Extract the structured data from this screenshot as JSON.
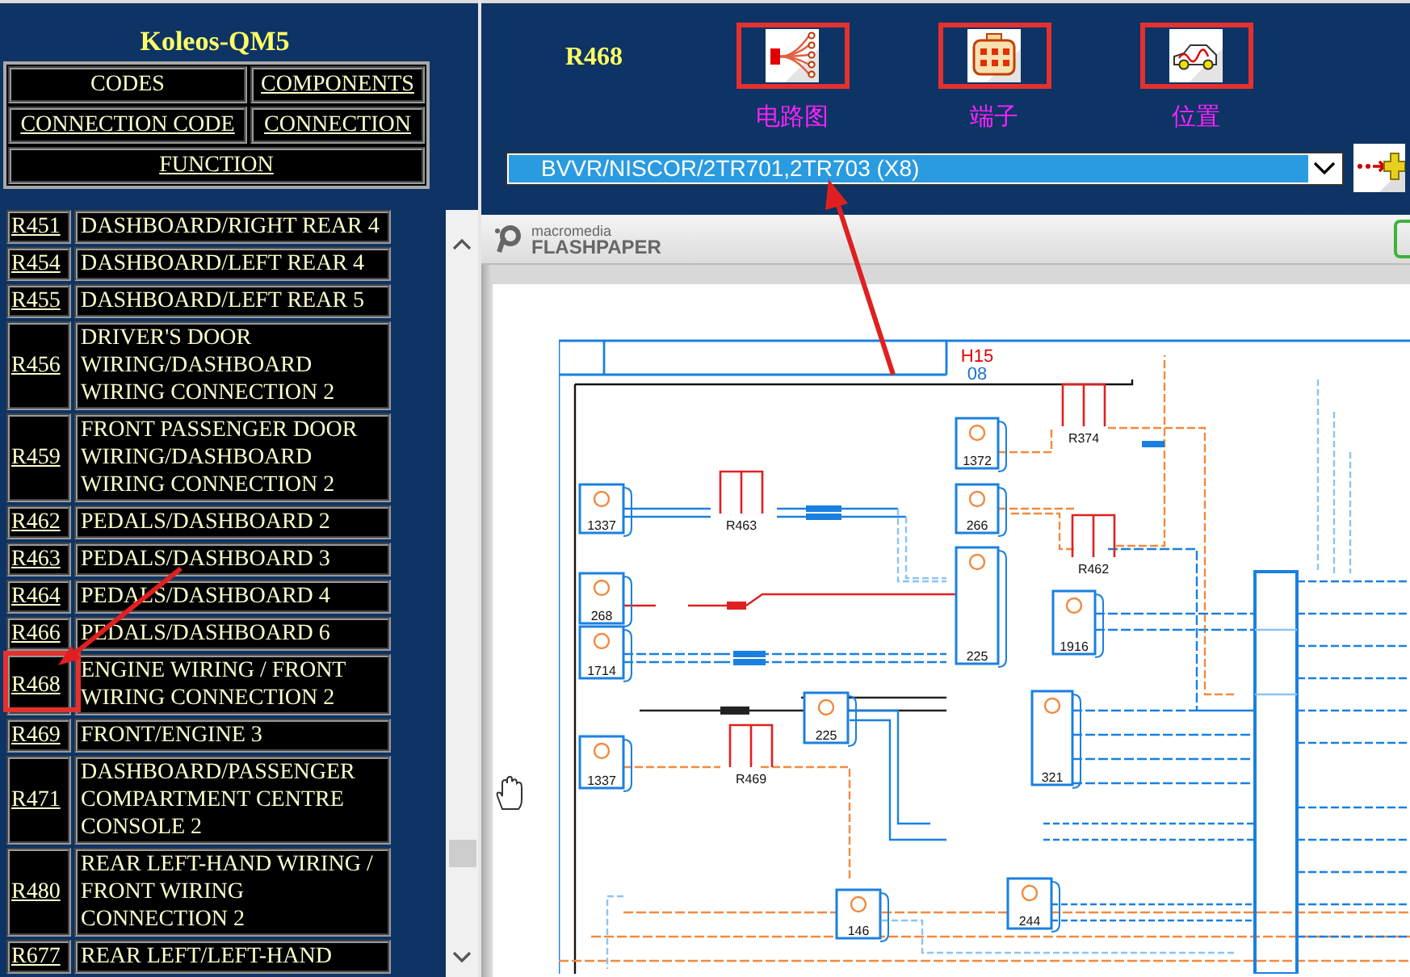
{
  "sidebar": {
    "title": "Koleos-QM5",
    "nav": [
      {
        "label": "CODES",
        "link": false
      },
      {
        "label": "COMPONENTS",
        "link": true
      },
      {
        "label": "CONNECTION CODE",
        "link": true
      },
      {
        "label": "CONNECTION",
        "link": true
      },
      {
        "label": "FUNCTION",
        "link": true
      }
    ],
    "rows": [
      {
        "code": "R451",
        "description": "DASHBOARD/RIGHT REAR 4"
      },
      {
        "code": "R454",
        "description": "DASHBOARD/LEFT REAR 4"
      },
      {
        "code": "R455",
        "description": "DASHBOARD/LEFT REAR 5"
      },
      {
        "code": "R456",
        "description": "DRIVER'S DOOR WIRING/DASHBOARD WIRING CONNECTION 2"
      },
      {
        "code": "R459",
        "description": "FRONT PASSENGER DOOR WIRING/DASHBOARD WIRING CONNECTION 2"
      },
      {
        "code": "R462",
        "description": "PEDALS/DASHBOARD 2"
      },
      {
        "code": "R463",
        "description": "PEDALS/DASHBOARD 3"
      },
      {
        "code": "R464",
        "description": "PEDALS/DASHBOARD 4"
      },
      {
        "code": "R466",
        "description": "PEDALS/DASHBOARD 6"
      },
      {
        "code": "R468",
        "description": "ENGINE WIRING / FRONT WIRING CONNECTION 2"
      },
      {
        "code": "R469",
        "description": "FRONT/ENGINE 3"
      },
      {
        "code": "R471",
        "description": "DASHBOARD/PASSENGER COMPARTMENT CENTRE CONSOLE 2"
      },
      {
        "code": "R480",
        "description": "REAR LEFT-HAND WIRING / FRONT WIRING CONNECTION 2"
      },
      {
        "code": "R677",
        "description": "REAR LEFT/LEFT-HAND"
      }
    ]
  },
  "connector": {
    "code": "R468",
    "views": [
      {
        "kind": "circuit",
        "label": "电路图"
      },
      {
        "kind": "terminal",
        "label": "端子"
      },
      {
        "kind": "location",
        "label": "位置"
      }
    ],
    "select": {
      "value": "BVVR/NISCOR/2TR701,2TR703 (X8)"
    }
  },
  "viewer": {
    "brand": "macromedia",
    "product": "FLASHPAPER",
    "diagram": {
      "sheet": "H15",
      "page": "08",
      "components": [
        {
          "kind": "module",
          "label": "1337"
        },
        {
          "kind": "module",
          "label": "268"
        },
        {
          "kind": "module",
          "label": "1714"
        },
        {
          "kind": "module",
          "label": "1337"
        },
        {
          "kind": "module",
          "label": "225"
        },
        {
          "kind": "module",
          "label": "146"
        },
        {
          "kind": "module",
          "label": "1372"
        },
        {
          "kind": "module",
          "label": "266"
        },
        {
          "kind": "module",
          "label": "225"
        },
        {
          "kind": "module",
          "label": "1916"
        },
        {
          "kind": "module",
          "label": "321"
        },
        {
          "kind": "module",
          "label": "244"
        },
        {
          "kind": "connector",
          "label": "R463"
        },
        {
          "kind": "connector",
          "label": "R469"
        },
        {
          "kind": "connector",
          "label": "R374"
        },
        {
          "kind": "connector",
          "label": "R462"
        }
      ]
    }
  }
}
